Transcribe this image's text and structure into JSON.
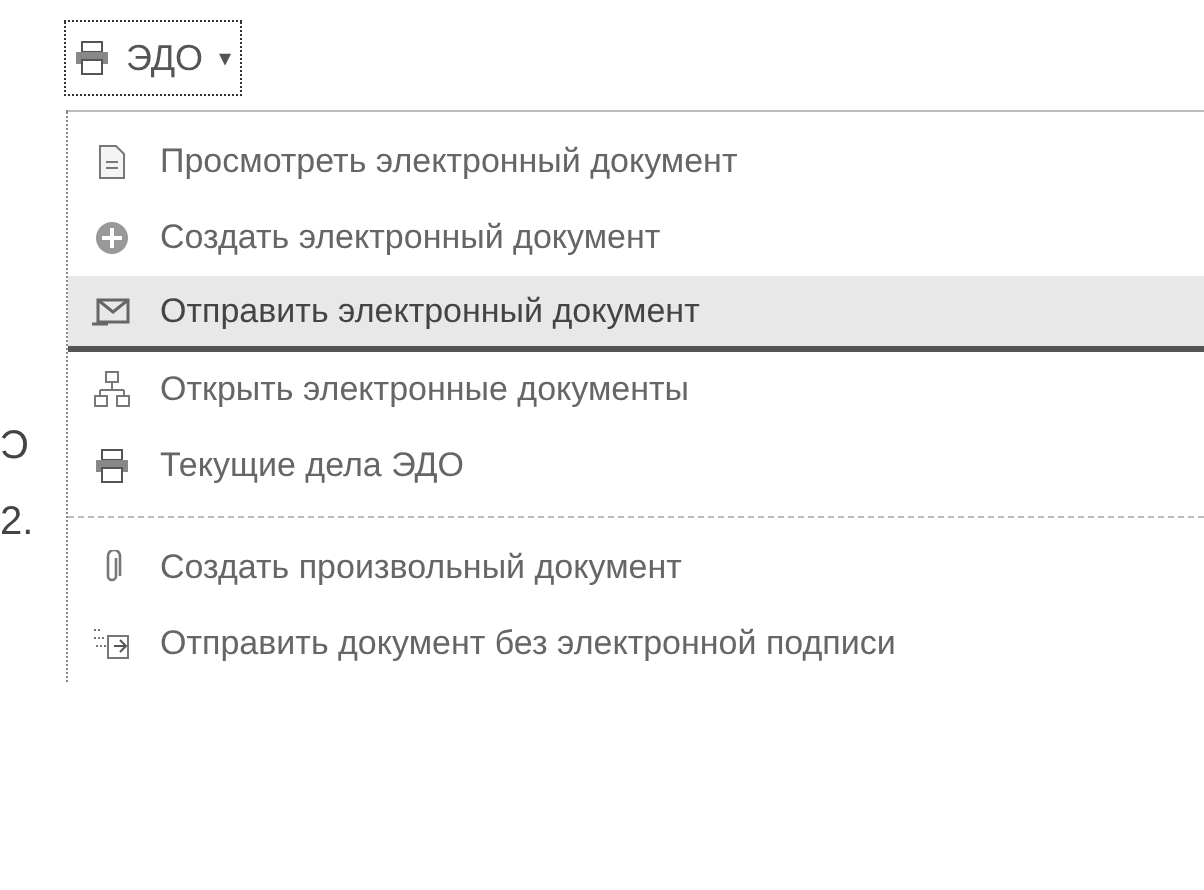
{
  "menu_button": {
    "label": "ЭДО",
    "caret": "▾"
  },
  "left_fragments": [
    "Ͻ",
    "2."
  ],
  "menu": {
    "groups": [
      [
        {
          "label": "Просмотреть электронный документ",
          "kind": "document",
          "selected": false
        },
        {
          "label": "Создать электронный документ",
          "kind": "create",
          "selected": false
        },
        {
          "label": "Отправить электронный документ",
          "kind": "send",
          "selected": true
        },
        {
          "label": "Открыть электронные документы",
          "kind": "tree",
          "selected": false
        },
        {
          "label": "Текущие дела ЭДО",
          "kind": "printer",
          "selected": false
        }
      ],
      [
        {
          "label": "Создать произвольный документ",
          "kind": "clip",
          "selected": false
        },
        {
          "label": "Отправить документ без электронной подписи",
          "kind": "sendplain",
          "selected": false
        }
      ]
    ]
  }
}
